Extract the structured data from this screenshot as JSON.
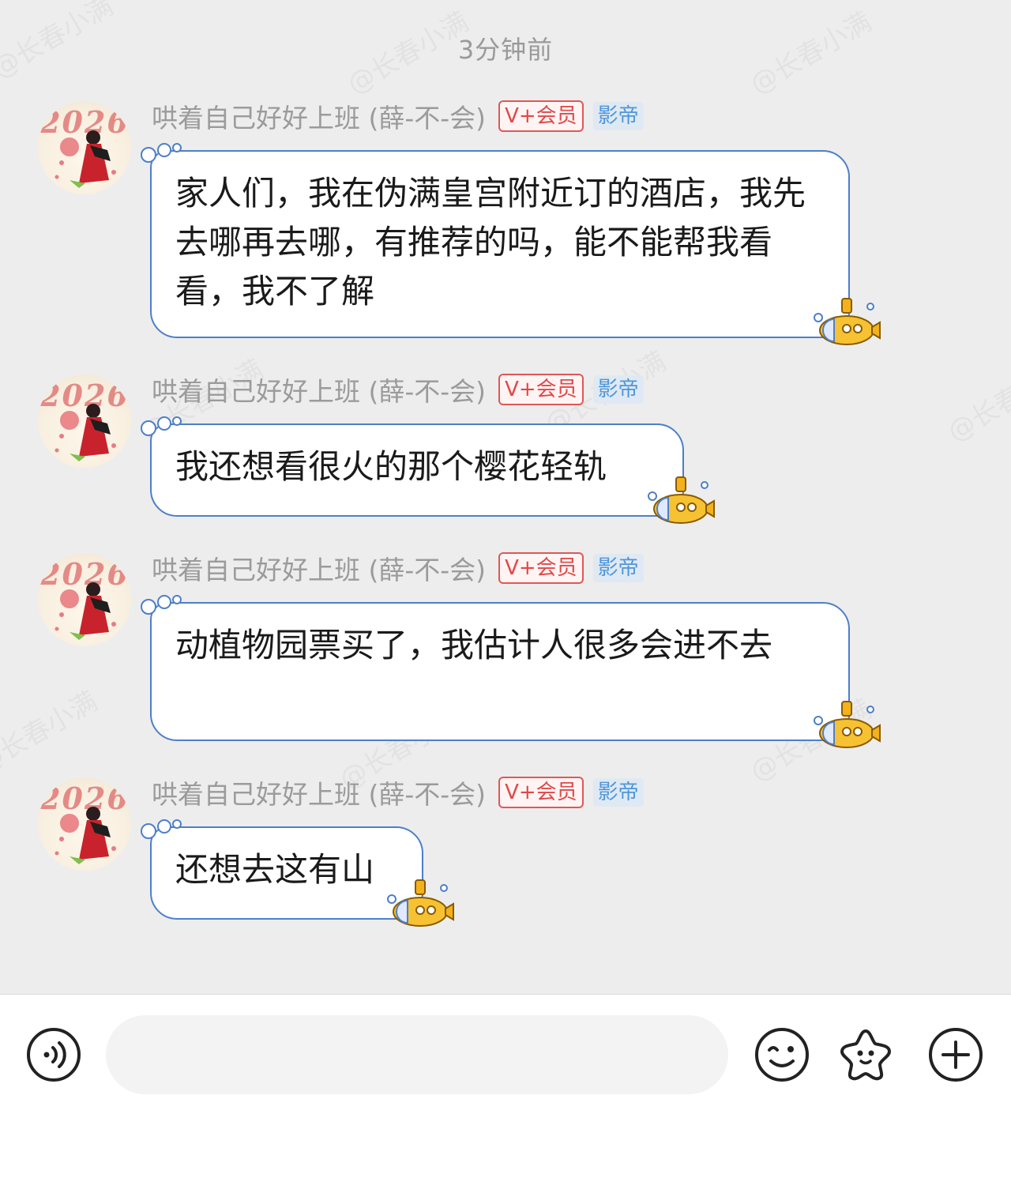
{
  "timestamp": "3分钟前",
  "watermark": "@长春小满",
  "sender": {
    "name": "哄着自己好好上班 (薛-不-会)",
    "badge_vip": "V+会员",
    "badge_title": "影帝",
    "avatar_text": "2026"
  },
  "messages": [
    {
      "text": "家人们，我在伪满皇宫附近订的酒店，我先去哪再去哪，有推荐的吗，能不能帮我看看，我不了解"
    },
    {
      "text": "我还想看很火的那个樱花轻轨"
    },
    {
      "text": "动植物园票买了，我估计人很多会进不去"
    },
    {
      "text": "还想去这有山"
    }
  ],
  "input": {
    "value": "",
    "placeholder": ""
  },
  "icons": [
    "voice-icon",
    "emoji-icon",
    "sticker-icon",
    "plus-icon"
  ],
  "colors": {
    "background": "#ededed",
    "bubble_border": "#4d7fc9",
    "vip_badge": "#e04848",
    "title_badge": "#4f96d9"
  }
}
